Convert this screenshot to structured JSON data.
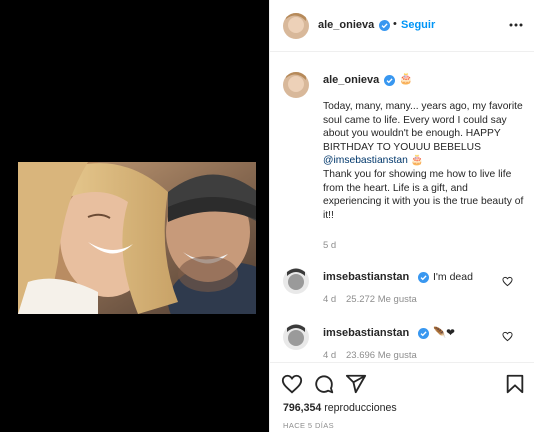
{
  "post": {
    "username": "ale_onieva",
    "follow_label": "Seguir",
    "separator": "•",
    "caption_badge": "🎂",
    "caption": {
      "part1": "Today, many, many... years ago, my favorite soul came to life. Every word I could say about you wouldn't be enough. HAPPY BIRTHDAY TO YOUUU BEBELUS ",
      "mention": "@imsebastianstan",
      "part2": " 🎂",
      "part3": "Thank you for showing me how to live life from the heart. Life is a gift, and experiencing it with you is the true beauty of it!!"
    },
    "caption_age": "5 d"
  },
  "comments": [
    {
      "username": "imsebastianstan",
      "text": "I'm dead",
      "age": "4 d",
      "likes": "25.272 Me gusta"
    },
    {
      "username": "imsebastianstan",
      "text": "🪶❤",
      "age": "4 d",
      "likes": "23.696 Me gusta"
    }
  ],
  "stats": {
    "views": "796,354",
    "views_label": " reproducciones",
    "time_ago": "HACE 5 DÍAS"
  },
  "icons": {
    "verified": "verified-badge-icon",
    "more": "more-options-icon",
    "like": "heart-icon",
    "comment": "comment-icon",
    "share": "share-icon",
    "save": "bookmark-icon"
  },
  "colors": {
    "accent": "#0095f6",
    "verified": "#3897f0",
    "mention": "#00376b",
    "muted": "#8e8e8e",
    "text": "#262626"
  }
}
